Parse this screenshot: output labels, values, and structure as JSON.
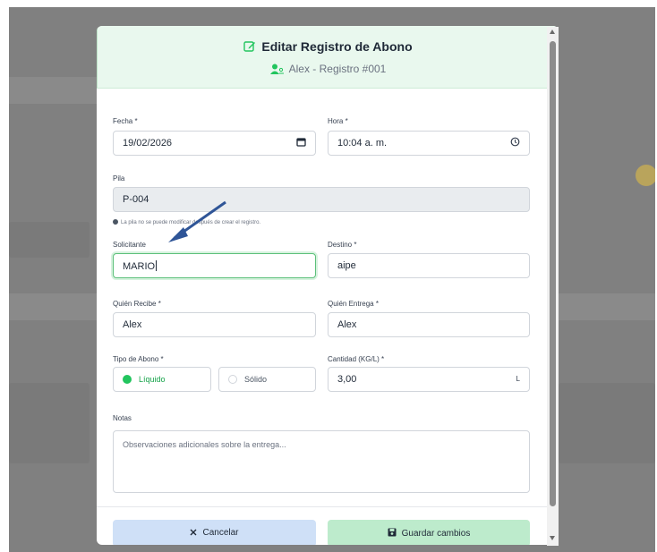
{
  "modal": {
    "title": "Editar Registro de Abono",
    "subtitle": "Alex - Registro #001"
  },
  "form": {
    "fecha": {
      "label": "Fecha *",
      "value": "19/02/2026"
    },
    "hora": {
      "label": "Hora *",
      "value": "10:04 a. m."
    },
    "pila": {
      "label": "Pila",
      "value": "P-004",
      "hint": "La pila no se puede modificar después de crear el registro."
    },
    "solicitante": {
      "label": "Solicitante",
      "value": "MARIO"
    },
    "destino": {
      "label": "Destino *",
      "value": "aipe"
    },
    "quien_recibe": {
      "label": "Quién Recibe *",
      "value": "Alex"
    },
    "quien_entrega": {
      "label": "Quién Entrega *",
      "value": "Alex"
    },
    "tipo_abono": {
      "label": "Tipo de Abono *",
      "options": [
        "Líquido",
        "Sólido"
      ],
      "selected": "Líquido"
    },
    "cantidad": {
      "label": "Cantidad (KG/L) *",
      "value": "3,00",
      "unit": "L"
    },
    "notas": {
      "label": "Notas",
      "placeholder": "Observaciones adicionales sobre la entrega..."
    }
  },
  "actions": {
    "cancel_label": "Cancelar",
    "save_label": "Guardar cambios"
  },
  "colors": {
    "header_bg": "#e9f8ee",
    "accent_green": "#22c55e",
    "cancel_bg": "#cfe0f7",
    "save_bg": "#bdebcc",
    "annotation_arrow": "#2f5597"
  },
  "icons": {
    "title": "edit-icon",
    "subtitle": "user-group-icon",
    "fecha": "calendar-icon",
    "hora": "clock-icon",
    "hint": "info-icon",
    "cancel": "close-icon",
    "save": "save-icon"
  }
}
